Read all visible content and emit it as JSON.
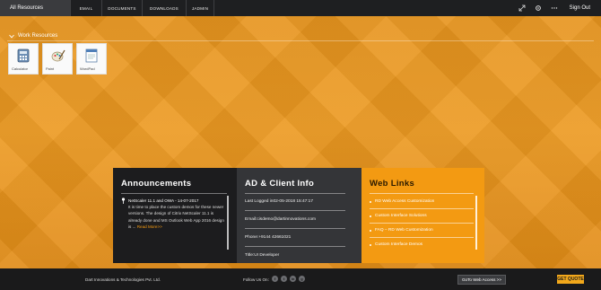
{
  "topbar": {
    "all_resources": "All Resources",
    "nav": [
      "EMAIL",
      "DOCUMENTS",
      "DOWNLOADS",
      "JADMIN"
    ],
    "sign_out": "Sign Out"
  },
  "work_resources": {
    "title": "Work Resources",
    "apps": [
      {
        "label": "Calculator",
        "icon": "calculator-icon"
      },
      {
        "label": "Paint",
        "icon": "paint-icon"
      },
      {
        "label": "WordPad",
        "icon": "wordpad-icon"
      }
    ]
  },
  "announcements": {
    "title": "Announcements",
    "item_head": "NetScaler 11.1 and OWA - 14-07-2017",
    "item_body": "It is time to place the custom demos for these newer versions. The design of Citrix NetScaler 11.1 is already done and MS Outlook Web App 2016 design is ...",
    "read_more": "Read More>>"
  },
  "ad_info": {
    "title": "AD & Client Info",
    "last_logged": "Last Logged in02-05-2018 15:47:17",
    "email": "Email:cisdemo@dartinnovations.com",
    "phone": "Phone:+9144 42661021",
    "title_row": "Title:UI Developer"
  },
  "web_links": {
    "title": "Web Links",
    "items": [
      "RD Web Access Customization",
      "Custom Interface Solutions",
      "FAQ – RD Web Customization",
      "Custom Interface Demos"
    ]
  },
  "footer": {
    "copyright": "Dart Innovations & Technologies Pvt. Ltd.",
    "follow": "Follow Us On:",
    "social": [
      "f",
      "t",
      "in",
      "g"
    ],
    "goto": "GoTo Web Access >>",
    "quote": "GET QUOTE"
  },
  "colors": {
    "accent": "#f39a12",
    "dark": "#1c1c1e"
  }
}
